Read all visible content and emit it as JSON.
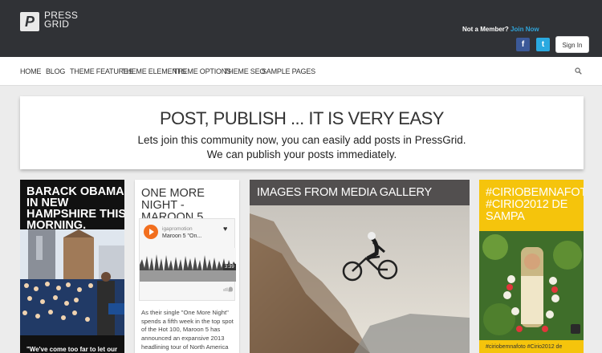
{
  "header": {
    "logo_mark": "P",
    "logo_line1": "PRESS",
    "logo_line2": "GRID",
    "member_text": "Not a Member?",
    "join_label": "Join Now",
    "facebook_glyph": "f",
    "twitter_glyph": "t",
    "signin_label": "Sign In"
  },
  "nav": {
    "items": [
      {
        "label": "HOME"
      },
      {
        "label": "BLOG"
      },
      {
        "label": "THEME FEATURES"
      },
      {
        "label": "THEME ELEMENTS"
      },
      {
        "label": "THEME OPTIONS"
      },
      {
        "label": "THEME SEO"
      },
      {
        "label": "SAMPLE PAGES"
      }
    ],
    "search_icon": "search-icon"
  },
  "hero": {
    "title": "POST, PUBLISH ... IT IS VERY EASY",
    "line1": "Lets join this community now, you can easily add posts in PressGrid.",
    "line2": "We can publish your posts immediately."
  },
  "cards": {
    "obama": {
      "title": "BARACK OBAMA IN NEW HAMPSHIRE THIS MORNING.",
      "quote": "\"We've come too far to let our"
    },
    "music": {
      "title": "ONE MORE NIGHT - MAROON 5",
      "player_user": "igapromotion",
      "player_track": "Maroon 5 \"On...",
      "player_time": "3:39",
      "text": "As their single \"One More Night\" spends a fifth week in the top spot of the Hot 100, Maroon 5 has announced an expansive 2013 headlining tour of North America"
    },
    "gallery": {
      "title": "IMAGES FROM MEDIA GALLERY"
    },
    "instagram": {
      "title": "#CIRIOBEMNAFOTO #CIRIO2012 DE SAMPA",
      "tags": "#ciriobemnafoto #Cirio2012 de"
    }
  },
  "colors": {
    "topbar": "#303236",
    "join": "#2fa3d8",
    "facebook": "#3b5998",
    "twitter": "#2aa9e0",
    "orange": "#f26f1f",
    "gallery_header": "#524f4f",
    "instagram_card": "#f5c40c"
  }
}
